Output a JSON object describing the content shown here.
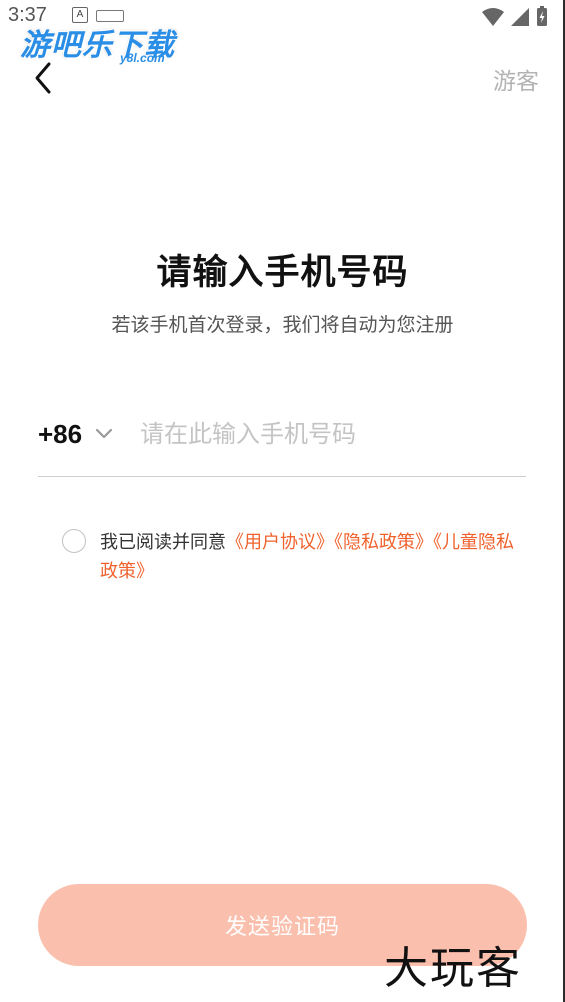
{
  "status_bar": {
    "time": "3:37",
    "a_badge": "A",
    "icons": [
      "wifi-icon",
      "cell-signal-icon",
      "battery-charging-icon"
    ]
  },
  "watermark_top": {
    "text": "游吧乐下载",
    "sub": "y8l.com"
  },
  "header": {
    "back_icon": "chevron-left-icon",
    "guest_label": "游客"
  },
  "title": "请输入手机号码",
  "subtitle": "若该手机首次登录，我们将自动为您注册",
  "phone": {
    "country_code": "+86",
    "placeholder": "请在此输入手机号码",
    "value": ""
  },
  "agreement": {
    "prefix": "我已阅读并同意",
    "links": [
      "《用户协议》",
      "《隐私政策》",
      "《儿童隐私政策》"
    ],
    "checked": false
  },
  "send_button": {
    "label": "发送验证码"
  },
  "watermark_bottom": "大玩客",
  "colors": {
    "accent": "#f0622d",
    "button_disabled": "#fbbfae",
    "placeholder": "#c4c4c4",
    "logo_blue": "#2a8ee6"
  }
}
